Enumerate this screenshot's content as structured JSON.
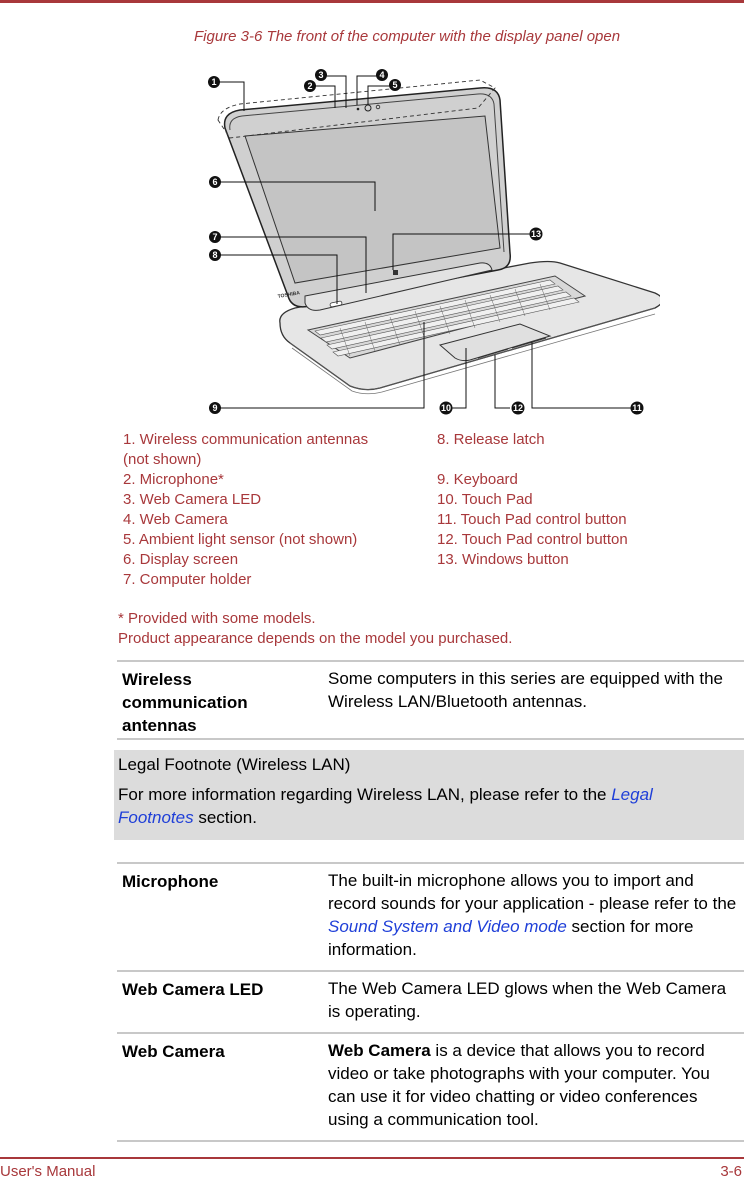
{
  "figure": {
    "caption": "Figure 3-6 The front of the computer with the display panel open",
    "brand_mark": "TOSHIBA",
    "callouts": [
      "1",
      "2",
      "3",
      "4",
      "5",
      "6",
      "7",
      "8",
      "9",
      "10",
      "11",
      "12",
      "13"
    ]
  },
  "legend": {
    "left": [
      "1. Wireless communication antennas",
      "(not shown)",
      "2. Microphone*",
      "3. Web Camera LED",
      "4. Web Camera",
      "5. Ambient light sensor (not shown)",
      "6. Display screen",
      "7. Computer holder"
    ],
    "right": [
      "8. Release latch",
      "",
      "9. Keyboard",
      "10. Touch Pad",
      "11. Touch Pad control button",
      "12. Touch Pad control button",
      "13. Windows button"
    ]
  },
  "notes": {
    "provided": "* Provided with some models.",
    "appearance": "Product appearance depends on the model you purchased."
  },
  "table1": {
    "rows": [
      {
        "term": "Wireless communication antennas",
        "desc": "Some computers in this series are equipped with the Wireless LAN/Bluetooth antennas."
      }
    ]
  },
  "legal": {
    "title": "Legal Footnote (Wireless LAN)",
    "body_before": "For more information regarding Wireless LAN, please refer to the ",
    "link": "Legal Footnotes",
    "body_after": " section."
  },
  "table2": {
    "rows": [
      {
        "term": "Microphone",
        "desc_before": "The built-in microphone allows you to import and record sounds for your application - please refer to the ",
        "desc_link": "Sound System and Video mode",
        "desc_after": " section for more information."
      },
      {
        "term": "Web Camera LED",
        "desc": "The Web Camera LED glows when the Web Camera is operating."
      },
      {
        "term": "Web Camera",
        "desc_bold": "Web Camera",
        "desc_after": " is a device that allows you to record video or take photographs with your computer. You can use it for video chatting or video conferences using a communication tool."
      }
    ]
  },
  "footer": {
    "left": "User's Manual",
    "right": "3-6"
  },
  "colors": {
    "accent": "#a8383b",
    "link": "#1f3fd8",
    "note_bg": "#dcdcdc",
    "rule": "#c8c8c8"
  }
}
